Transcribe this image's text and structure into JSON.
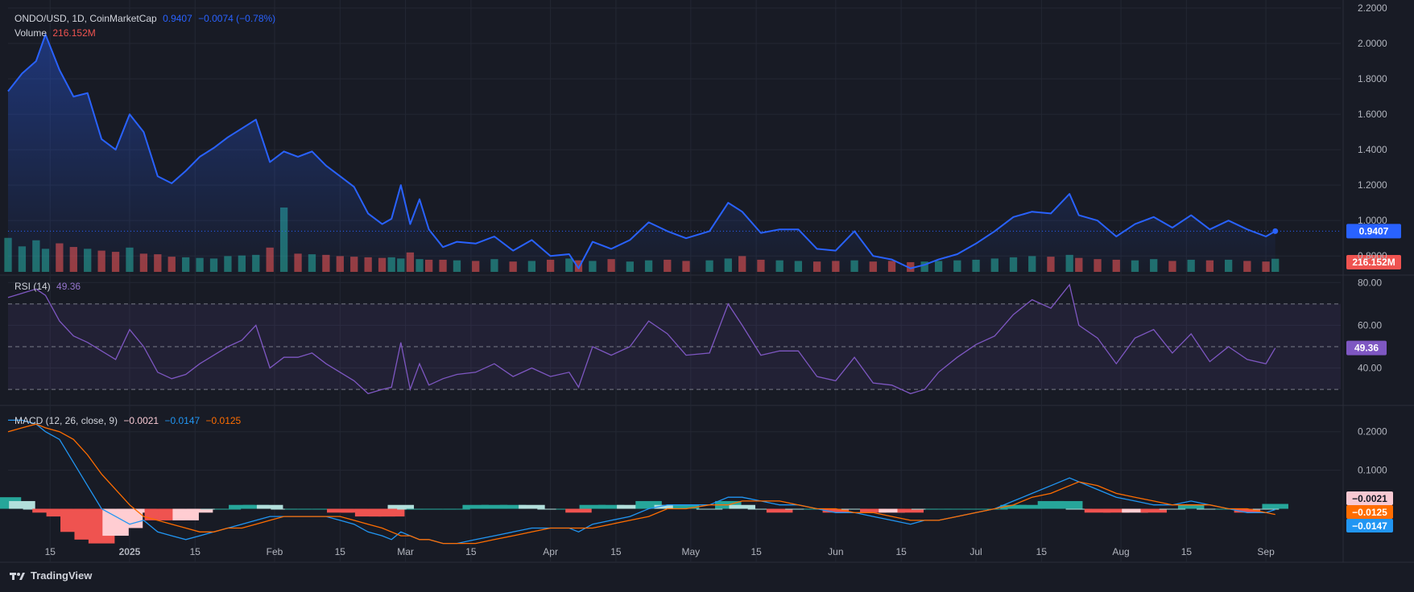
{
  "header": {
    "symbol": "ONDO/USD, 1D, CoinMarketCap",
    "last": "0.9407",
    "change": "−0.0074 (−0.78%)",
    "volume_label": "Volume",
    "volume_value": "216.152M"
  },
  "rsi_legend": {
    "label": "RSI (14)",
    "value": "49.36"
  },
  "macd_legend": {
    "label": "MACD (12, 26, close, 9)",
    "macd": "−0.0021",
    "signal": "−0.0147",
    "hist": "−0.0125"
  },
  "brand": "TradingView",
  "colors": {
    "background": "#181b25",
    "price_line": "#2962ff",
    "rsi_line": "#7e57c2",
    "macd_line": "#2196f3",
    "signal_line": "#ff6d00",
    "up": "#26a69a",
    "down": "#ef5350"
  },
  "chart_data": {
    "type": "line",
    "price": {
      "x": [
        "2024-12-06",
        "2024-12-09",
        "2024-12-12",
        "2024-12-14",
        "2024-12-17",
        "2024-12-20",
        "2024-12-23",
        "2024-12-26",
        "2024-12-29",
        "2025-01-01",
        "2025-01-04",
        "2025-01-07",
        "2025-01-10",
        "2025-01-13",
        "2025-01-16",
        "2025-01-19",
        "2025-01-22",
        "2025-01-25",
        "2025-01-28",
        "2025-01-31",
        "2025-02-03",
        "2025-02-06",
        "2025-02-09",
        "2025-02-12",
        "2025-02-15",
        "2025-02-18",
        "2025-02-21",
        "2025-02-24",
        "2025-02-26",
        "2025-02-28",
        "2025-03-02",
        "2025-03-04",
        "2025-03-06",
        "2025-03-09",
        "2025-03-12",
        "2025-03-16",
        "2025-03-20",
        "2025-03-24",
        "2025-03-28",
        "2025-04-01",
        "2025-04-05",
        "2025-04-07",
        "2025-04-10",
        "2025-04-14",
        "2025-04-18",
        "2025-04-22",
        "2025-04-26",
        "2025-04-30",
        "2025-05-05",
        "2025-05-09",
        "2025-05-12",
        "2025-05-16",
        "2025-05-20",
        "2025-05-24",
        "2025-05-28",
        "2025-06-01",
        "2025-06-05",
        "2025-06-09",
        "2025-06-13",
        "2025-06-17",
        "2025-06-20",
        "2025-06-23",
        "2025-06-27",
        "2025-07-01",
        "2025-07-05",
        "2025-07-09",
        "2025-07-13",
        "2025-07-17",
        "2025-07-21",
        "2025-07-23",
        "2025-07-27",
        "2025-07-31",
        "2025-08-04",
        "2025-08-08",
        "2025-08-12",
        "2025-08-16",
        "2025-08-20",
        "2025-08-24",
        "2025-08-28",
        "2025-09-01",
        "2025-09-03"
      ],
      "y": [
        1.73,
        1.83,
        1.9,
        2.05,
        1.85,
        1.7,
        1.72,
        1.46,
        1.4,
        1.6,
        1.5,
        1.25,
        1.21,
        1.28,
        1.36,
        1.41,
        1.47,
        1.52,
        1.57,
        1.33,
        1.39,
        1.36,
        1.39,
        1.31,
        1.25,
        1.19,
        1.04,
        0.98,
        1.01,
        1.2,
        0.98,
        1.12,
        0.95,
        0.85,
        0.88,
        0.87,
        0.91,
        0.83,
        0.89,
        0.8,
        0.81,
        0.73,
        0.88,
        0.84,
        0.89,
        0.99,
        0.94,
        0.9,
        0.94,
        1.1,
        1.05,
        0.93,
        0.95,
        0.95,
        0.84,
        0.83,
        0.94,
        0.8,
        0.78,
        0.73,
        0.75,
        0.78,
        0.81,
        0.87,
        0.94,
        1.02,
        1.05,
        1.04,
        1.15,
        1.03,
        1.0,
        0.91,
        0.98,
        1.02,
        0.96,
        1.03,
        0.95,
        1.0,
        0.95,
        0.91,
        0.94
      ],
      "ylim": [
        0.71,
        2.2
      ],
      "yticks": [
        "0.8000",
        "1.0000",
        "1.2000",
        "1.4000",
        "1.6000",
        "1.8000",
        "2.0000",
        "2.2000"
      ],
      "last_label": "0.9407"
    },
    "volume": {
      "y_million": [
        560,
        420,
        520,
        380,
        470,
        410,
        380,
        350,
        330,
        400,
        300,
        290,
        250,
        240,
        230,
        220,
        260,
        270,
        280,
        400,
        1060,
        300,
        290,
        280,
        260,
        250,
        240,
        230,
        240,
        220,
        320,
        210,
        200,
        200,
        190,
        180,
        210,
        170,
        180,
        200,
        220,
        190,
        180,
        210,
        170,
        190,
        200,
        180,
        190,
        220,
        260,
        200,
        190,
        180,
        170,
        180,
        190,
        170,
        180,
        160,
        170,
        180,
        190,
        200,
        220,
        240,
        260,
        250,
        280,
        230,
        210,
        200,
        190,
        210,
        180,
        200,
        190,
        200,
        180,
        170,
        216
      ],
      "last_label": "216.152M"
    },
    "rsi": {
      "y": [
        73,
        75,
        77,
        74,
        62,
        55,
        52,
        48,
        44,
        58,
        50,
        38,
        35,
        37,
        42,
        46,
        50,
        53,
        60,
        40,
        45,
        45,
        47,
        42,
        38,
        34,
        28,
        30,
        31,
        52,
        30,
        42,
        32,
        35,
        37,
        38,
        42,
        36,
        40,
        36,
        38,
        31,
        50,
        46,
        50,
        62,
        56,
        46,
        47,
        70,
        60,
        46,
        48,
        48,
        36,
        34,
        45,
        33,
        32,
        28,
        30,
        38,
        45,
        51,
        55,
        65,
        72,
        68,
        79,
        60,
        54,
        42,
        54,
        58,
        47,
        56,
        43,
        50,
        44,
        42,
        49.36
      ],
      "ylim": [
        24,
        82
      ],
      "yticks": [
        "40.00",
        "60.00",
        "80.00"
      ],
      "bands": [
        30,
        50,
        70
      ],
      "last_label": "49.36"
    },
    "macd": {
      "macd": [
        0.23,
        0.23,
        0.22,
        0.2,
        0.18,
        0.12,
        0.06,
        0.0,
        -0.02,
        -0.04,
        -0.03,
        -0.06,
        -0.07,
        -0.08,
        -0.07,
        -0.06,
        -0.05,
        -0.04,
        -0.03,
        -0.02,
        -0.02,
        -0.02,
        -0.02,
        -0.02,
        -0.03,
        -0.04,
        -0.06,
        -0.07,
        -0.08,
        -0.06,
        -0.07,
        -0.08,
        -0.08,
        -0.09,
        -0.09,
        -0.08,
        -0.07,
        -0.06,
        -0.05,
        -0.05,
        -0.05,
        -0.06,
        -0.04,
        -0.03,
        -0.02,
        0.0,
        0.01,
        0.01,
        0.01,
        0.03,
        0.03,
        0.02,
        0.01,
        0.01,
        0.0,
        -0.01,
        -0.01,
        -0.02,
        -0.03,
        -0.04,
        -0.03,
        -0.03,
        -0.02,
        -0.01,
        0.0,
        0.02,
        0.04,
        0.06,
        0.08,
        0.07,
        0.05,
        0.03,
        0.02,
        0.01,
        0.01,
        0.02,
        0.01,
        0.0,
        -0.01,
        -0.01,
        -0.0021
      ],
      "signal": [
        0.2,
        0.21,
        0.22,
        0.21,
        0.2,
        0.18,
        0.14,
        0.09,
        0.05,
        0.01,
        -0.02,
        -0.03,
        -0.04,
        -0.05,
        -0.06,
        -0.06,
        -0.05,
        -0.05,
        -0.04,
        -0.03,
        -0.02,
        -0.02,
        -0.02,
        -0.02,
        -0.02,
        -0.03,
        -0.04,
        -0.05,
        -0.06,
        -0.07,
        -0.07,
        -0.08,
        -0.08,
        -0.09,
        -0.09,
        -0.09,
        -0.08,
        -0.07,
        -0.06,
        -0.05,
        -0.05,
        -0.05,
        -0.05,
        -0.04,
        -0.03,
        -0.02,
        0.0,
        0.0,
        0.01,
        0.01,
        0.02,
        0.02,
        0.02,
        0.01,
        0.0,
        0.0,
        -0.01,
        -0.01,
        -0.02,
        -0.03,
        -0.03,
        -0.03,
        -0.02,
        -0.01,
        0.0,
        0.01,
        0.03,
        0.04,
        0.06,
        0.07,
        0.06,
        0.04,
        0.03,
        0.02,
        0.01,
        0.01,
        0.01,
        0.0,
        0.0,
        -0.01,
        -0.0147
      ],
      "ylim": [
        -0.12,
        0.26
      ],
      "yticks": [
        "0.1000",
        "0.2000"
      ],
      "labels": [
        "−0.0021",
        "−0.0125",
        "−0.0147"
      ]
    },
    "x_axis": {
      "ticks": [
        {
          "label": "15",
          "date": "2024-12-15",
          "bold": false
        },
        {
          "label": "2025",
          "date": "2025-01-01",
          "bold": true
        },
        {
          "label": "15",
          "date": "2025-01-15",
          "bold": false
        },
        {
          "label": "Feb",
          "date": "2025-02-01",
          "bold": false
        },
        {
          "label": "15",
          "date": "2025-02-15",
          "bold": false
        },
        {
          "label": "Mar",
          "date": "2025-03-01",
          "bold": false
        },
        {
          "label": "15",
          "date": "2025-03-15",
          "bold": false
        },
        {
          "label": "Apr",
          "date": "2025-04-01",
          "bold": false
        },
        {
          "label": "15",
          "date": "2025-04-15",
          "bold": false
        },
        {
          "label": "May",
          "date": "2025-05-01",
          "bold": false
        },
        {
          "label": "15",
          "date": "2025-05-15",
          "bold": false
        },
        {
          "label": "Jun",
          "date": "2025-06-01",
          "bold": false
        },
        {
          "label": "15",
          "date": "2025-06-15",
          "bold": false
        },
        {
          "label": "Jul",
          "date": "2025-07-01",
          "bold": false
        },
        {
          "label": "15",
          "date": "2025-07-15",
          "bold": false
        },
        {
          "label": "Aug",
          "date": "2025-08-01",
          "bold": false
        },
        {
          "label": "15",
          "date": "2025-08-15",
          "bold": false
        },
        {
          "label": "Sep",
          "date": "2025-09-01",
          "bold": false
        }
      ],
      "range": [
        "2024-12-06",
        "2025-09-17"
      ]
    },
    "grid": true
  }
}
